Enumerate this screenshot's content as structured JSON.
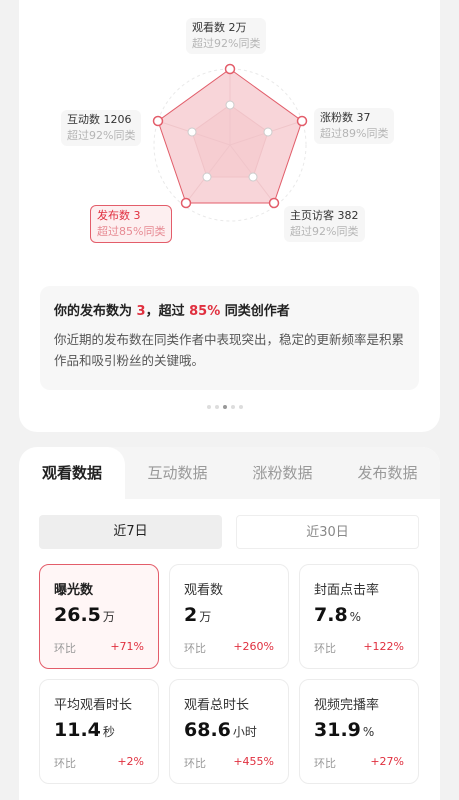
{
  "radar": {
    "labels": [
      {
        "title": "观看数 2万",
        "sub": "超过92%同类",
        "active": false
      },
      {
        "title": "涨粉数 37",
        "sub": "超过89%同类",
        "active": false
      },
      {
        "title": "主页访客 382",
        "sub": "超过92%同类",
        "active": false
      },
      {
        "title": "发布数 3",
        "sub": "超过85%同类",
        "active": true
      },
      {
        "title": "互动数 1206",
        "sub": "超过92%同类",
        "active": false
      }
    ],
    "colors": {
      "accent": "#e35d6a",
      "fill": "#f9d9dc",
      "grid": "#e6e6e6"
    }
  },
  "insight": {
    "title_prefix": "你的发布数为",
    "title_value": "3",
    "title_mid": "，超过",
    "title_percent": "85%",
    "title_suffix": "同类创作者",
    "body": "你近期的发布数在同类作者中表现突出，稳定的更新频率是积累作品和吸引粉丝的关键哦。"
  },
  "tabs": [
    "观看数据",
    "互动数据",
    "涨粉数据",
    "发布数据"
  ],
  "periods": [
    "近7日",
    "近30日"
  ],
  "compare_label": "环比",
  "metrics": [
    {
      "label": "曝光数",
      "value": "26.5",
      "unit": "万",
      "change": "+71%"
    },
    {
      "label": "观看数",
      "value": "2",
      "unit": "万",
      "change": "+260%"
    },
    {
      "label": "封面点击率",
      "value": "7.8",
      "unit": "%",
      "change": "+122%"
    },
    {
      "label": "平均观看时长",
      "value": "11.4",
      "unit": "秒",
      "change": "+2%"
    },
    {
      "label": "观看总时长",
      "value": "68.6",
      "unit": "小时",
      "change": "+455%"
    },
    {
      "label": "视频完播率",
      "value": "31.9",
      "unit": "%",
      "change": "+27%"
    }
  ]
}
